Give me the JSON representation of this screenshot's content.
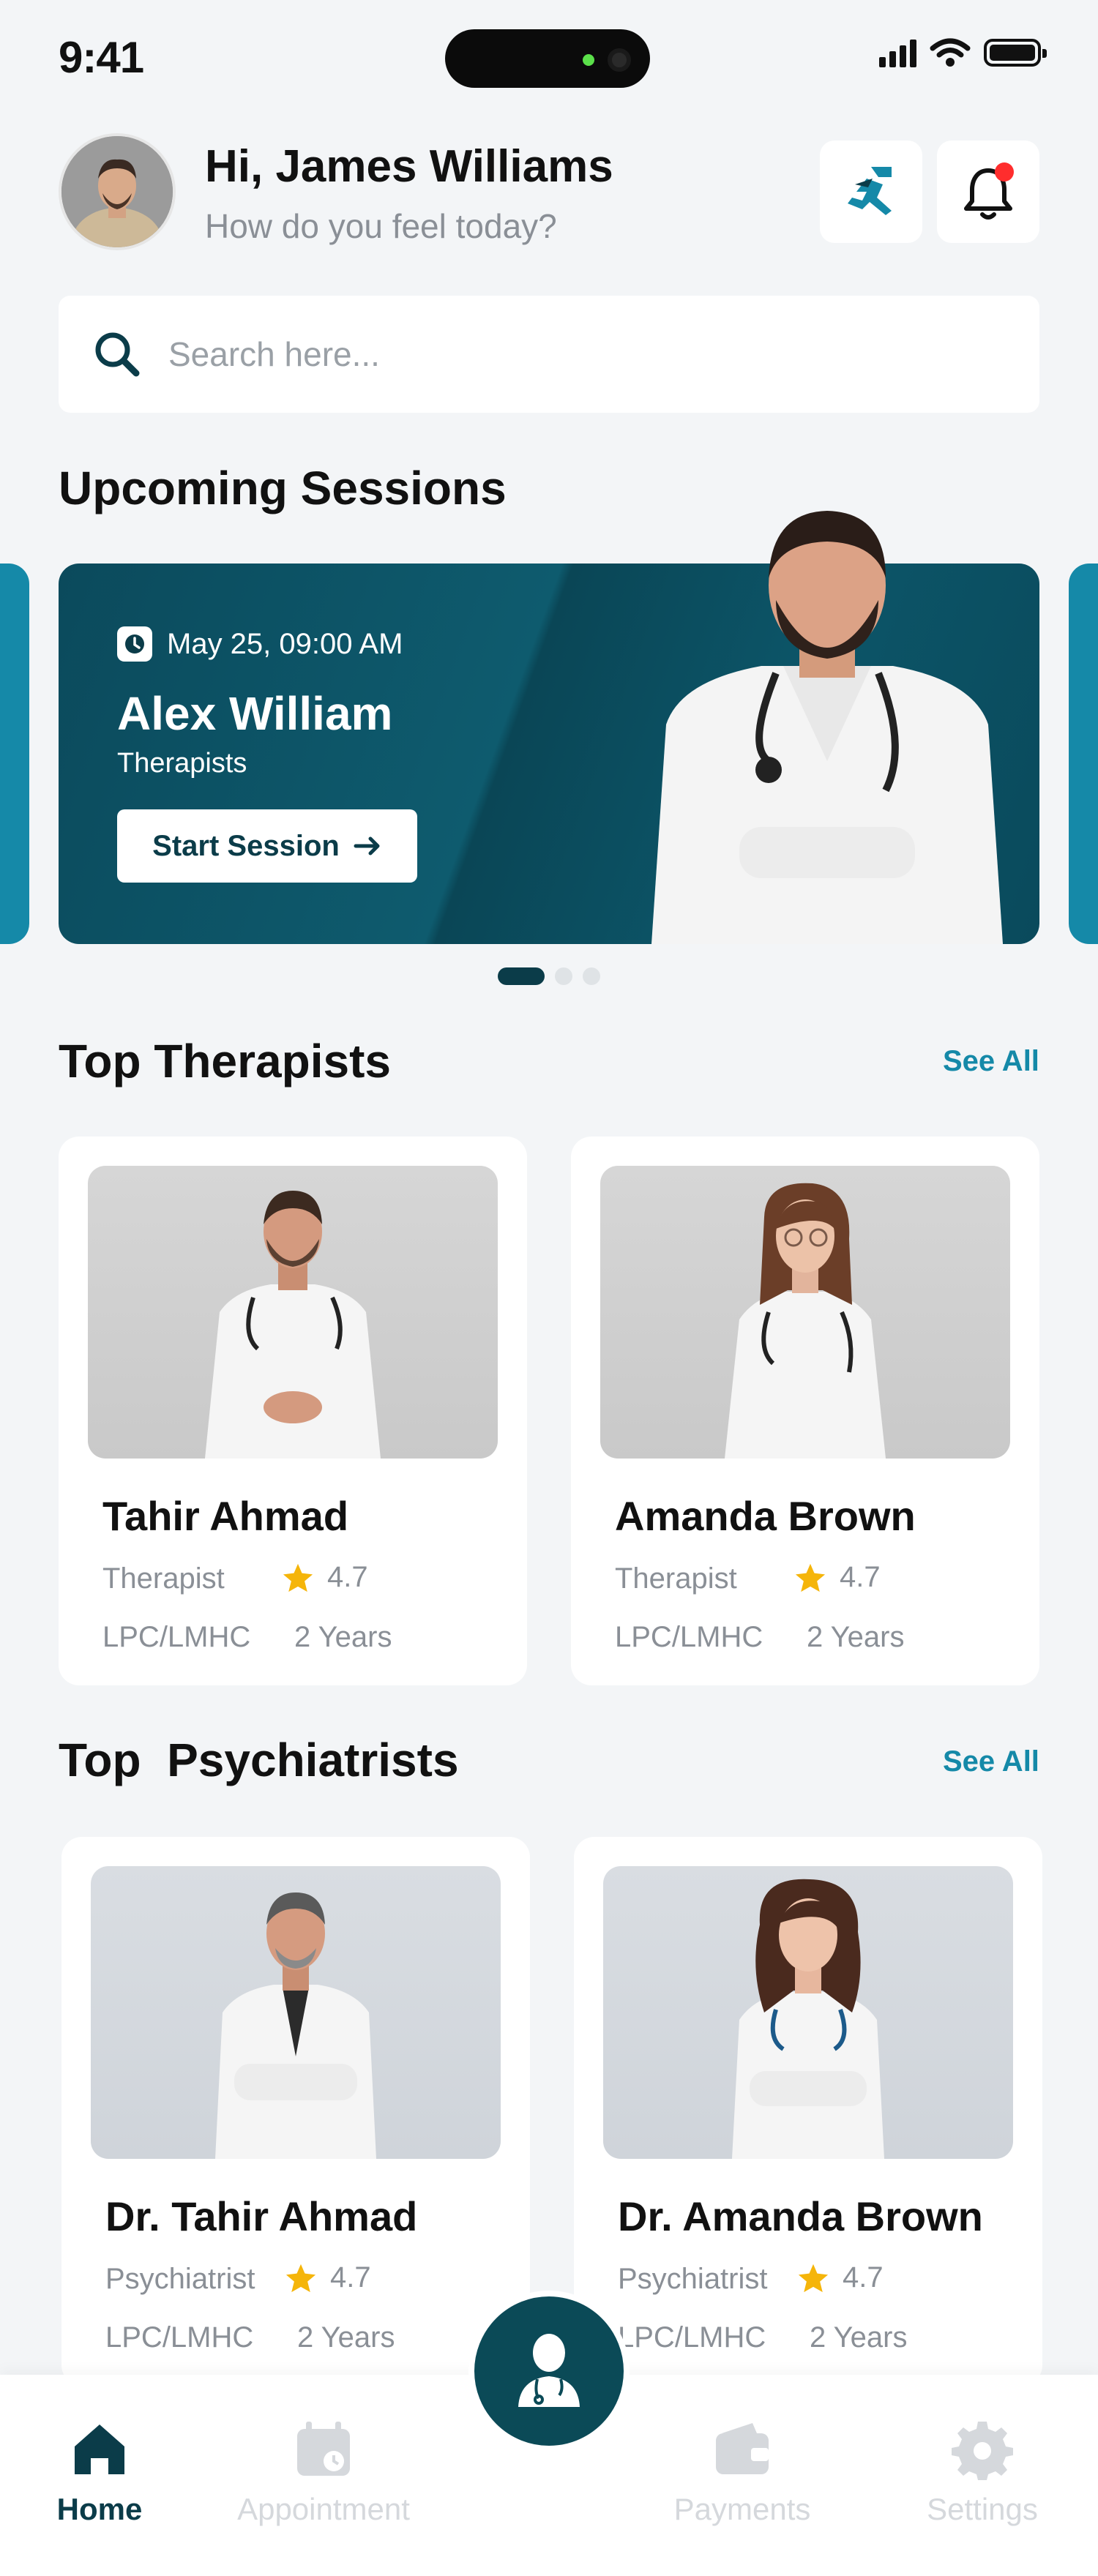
{
  "status_bar": {
    "time": "9:41"
  },
  "header": {
    "greeting": "Hi, James Williams",
    "subtitle": "How do you feel today?"
  },
  "search": {
    "placeholder": "Search here..."
  },
  "upcoming": {
    "title": "Upcoming Sessions",
    "session": {
      "date": "May 25, 09:00 AM",
      "name": "Alex William",
      "role": "Therapists",
      "button_label": "Start Session"
    },
    "pagination": {
      "total": 3,
      "active": 1
    }
  },
  "top_therapists": {
    "title": "Top Therapists",
    "see_all": "See All",
    "items": [
      {
        "name": "Tahir Ahmad",
        "role": "Therapist",
        "rating": "4.7",
        "credential": "LPC/LMHC",
        "experience": "2 Years"
      },
      {
        "name": "Amanda Brown",
        "role": "Therapist",
        "rating": "4.7",
        "credential": "LPC/LMHC",
        "experience": "2 Years"
      }
    ]
  },
  "top_psychiatrists": {
    "title": "Top  Psychiatrists",
    "see_all": "See All",
    "items": [
      {
        "name": "Dr. Tahir Ahmad",
        "role": "Psychiatrist",
        "rating": "4.7",
        "credential": "LPC/LMHC",
        "experience": "2 Years"
      },
      {
        "name": "Dr. Amanda Brown",
        "role": "Psychiatrist",
        "rating": "4.7",
        "credential": "LPC/LMHC",
        "experience": "2 Years"
      }
    ]
  },
  "nav": {
    "home": "Home",
    "appointment": "Appointment",
    "payments": "Payments",
    "settings": "Settings"
  },
  "colors": {
    "brand_dark": "#0b3c49",
    "accent": "#1589a8",
    "star": "#f5b50a",
    "notification_dot": "#ff2d2d"
  },
  "icons": [
    "search-icon",
    "running-figure-icon",
    "bell-icon",
    "clock-icon",
    "arrow-right-icon",
    "star-icon",
    "home-icon",
    "calendar-icon",
    "wallet-icon",
    "gear-icon",
    "doctor-icon"
  ]
}
